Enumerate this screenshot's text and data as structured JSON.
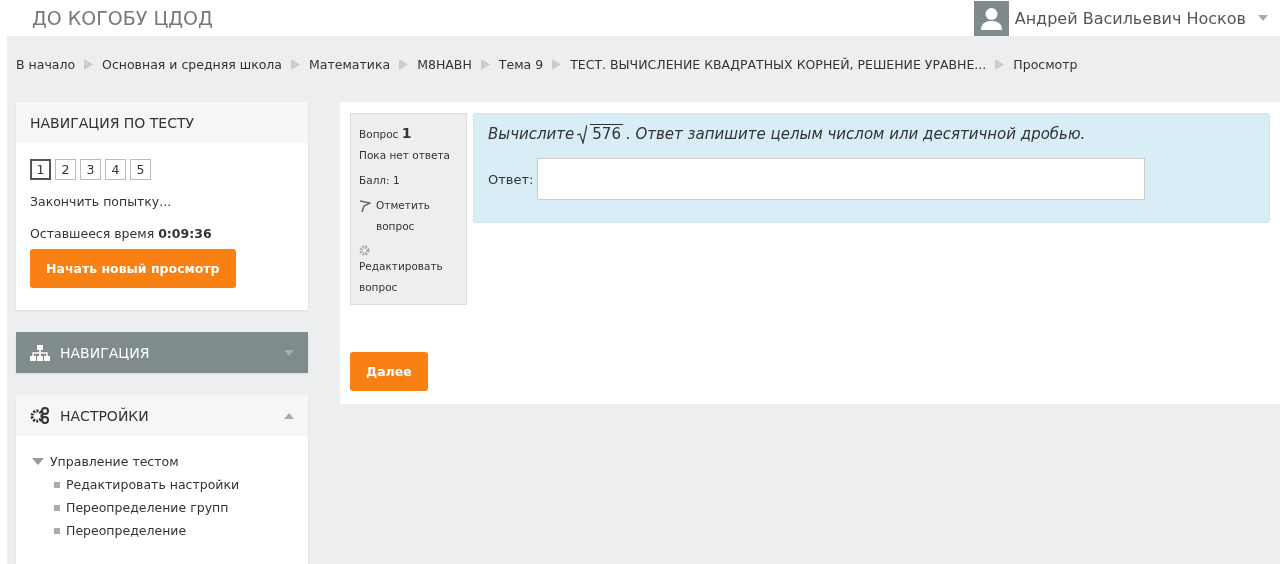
{
  "header": {
    "site_name": "ДО КОГОБУ ЦДОД",
    "user_name": "Андрей Васильевич Носков"
  },
  "breadcrumb": [
    "В начало",
    "Основная и средняя школа",
    "Математика",
    "M8HABH",
    "Тема 9",
    "ТЕСТ. ВЫЧИСЛЕНИЕ КВАДРАТНЫХ КОРНЕЙ, РЕШЕНИЕ УРАВНЕ...",
    "Просмотр"
  ],
  "quiz_nav": {
    "title": "НАВИГАЦИЯ ПО ТЕСТУ",
    "questions": [
      {
        "label": "1",
        "selected": true
      },
      {
        "label": "2",
        "selected": false
      },
      {
        "label": "3",
        "selected": false
      },
      {
        "label": "4",
        "selected": false
      },
      {
        "label": "5",
        "selected": false
      }
    ],
    "finish_link": "Закончить попытку...",
    "time_label": "Оставшееся время",
    "time_value": "0:09:36",
    "restart_button": "Начать новый просмотр"
  },
  "blocks": [
    {
      "kind": "navigation",
      "title": "НАВИГАЦИЯ",
      "expanded": false
    },
    {
      "kind": "settings",
      "title": "НАСТРОЙКИ",
      "expanded": true,
      "tree": [
        {
          "label": "Управление тестом",
          "expanded": true,
          "children": [
            {
              "label": "Редактировать настройки"
            },
            {
              "label": "Переопределение групп"
            },
            {
              "label": "Переопределение"
            }
          ]
        }
      ]
    }
  ],
  "question": {
    "label": "Вопрос",
    "number": "1",
    "status": "Пока нет ответа",
    "grade": "Балл: 1",
    "flag_link": "Отметить вопрос",
    "edit_link": "Редактировать вопрос",
    "text_before": "Вычислите",
    "radicand": "576",
    "text_after": ". Ответ запишите целым числом или десятичной дробью.",
    "answer_label": "Ответ:"
  },
  "next_button": "Далее"
}
